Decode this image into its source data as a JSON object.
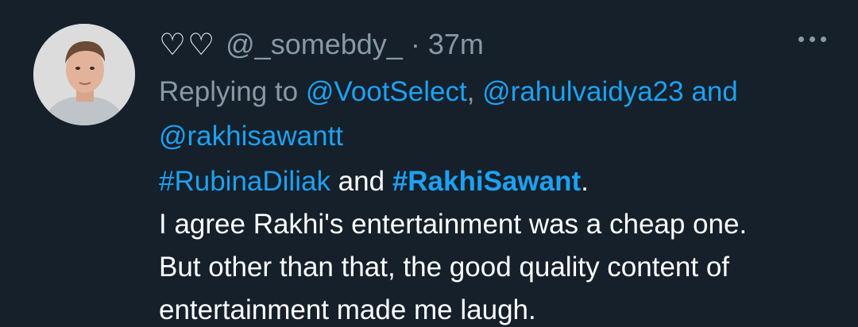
{
  "tweet": {
    "display_name": "♡♡",
    "handle": "@_somebdy_",
    "separator": "·",
    "time": "37m",
    "more_label": "•••",
    "reply": {
      "prefix": "Replying to ",
      "mention1": "@VootSelect",
      "comma": ", ",
      "mention2": "@rahulvaidya23",
      "and": " and",
      "mention3": "@rakhisawantt"
    },
    "body": {
      "hashtag1": "#RubinaDiliak",
      "and_text": " and ",
      "hashtag2": "#RakhiSawant",
      "period": ".",
      "line2": "I agree Rakhi's entertainment was a cheap one.",
      "line3": "But other than that, the good quality content of",
      "line4": "entertainment made me laugh."
    }
  },
  "colors": {
    "background": "#15202b",
    "muted": "#8899a6",
    "link": "#1da1f2",
    "text": "#ffffff"
  }
}
